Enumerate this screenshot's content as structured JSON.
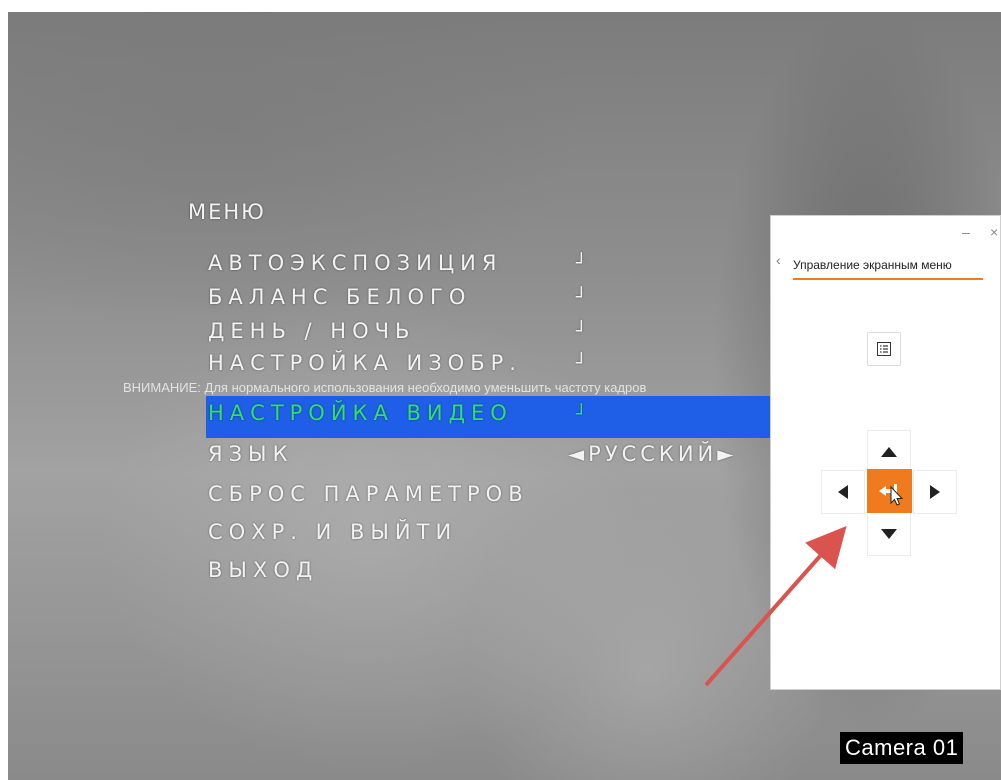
{
  "osd_menu": {
    "title": "МЕНЮ",
    "items": [
      {
        "label": "АВТОЭКСПОЗИЦИЯ",
        "value": "┘"
      },
      {
        "label": "БАЛАНС БЕЛОГО",
        "value": "┘"
      },
      {
        "label": "ДЕНЬ / НОЧЬ",
        "value": "┘"
      },
      {
        "label": "НАСТРОЙКА ИЗОБР.",
        "value": "┘"
      },
      {
        "label": "НАСТРОЙКА ВИДЕО",
        "value": "┘"
      },
      {
        "label": "ЯЗЫК",
        "value": "◄РУССКИЙ►"
      },
      {
        "label": "СБРОС ПАРАМЕТРОВ",
        "value": ""
      },
      {
        "label": "СОХР. И ВЫЙТИ",
        "value": ""
      },
      {
        "label": "ВЫХОД",
        "value": ""
      }
    ],
    "highlight_color": "#1f5fe8",
    "active_text_color": "#2ee06e"
  },
  "warning_text": "ВНИМАНИЕ: Для нормального использования необходимо уменьшить частоту кадров",
  "camera_label": "Camera 01",
  "panel": {
    "title": "Управление экранным меню",
    "back_icon": "‹",
    "minimize_icon": "–",
    "close_icon": "×",
    "accent_color": "#f07a1e"
  },
  "icons": {
    "menu": "list-icon",
    "up": "arrow-up-icon",
    "down": "arrow-down-icon",
    "left": "arrow-left-icon",
    "right": "arrow-right-icon",
    "enter": "enter-icon",
    "cursor": "mouse-cursor-icon"
  },
  "annotation_color": "#d9534f"
}
